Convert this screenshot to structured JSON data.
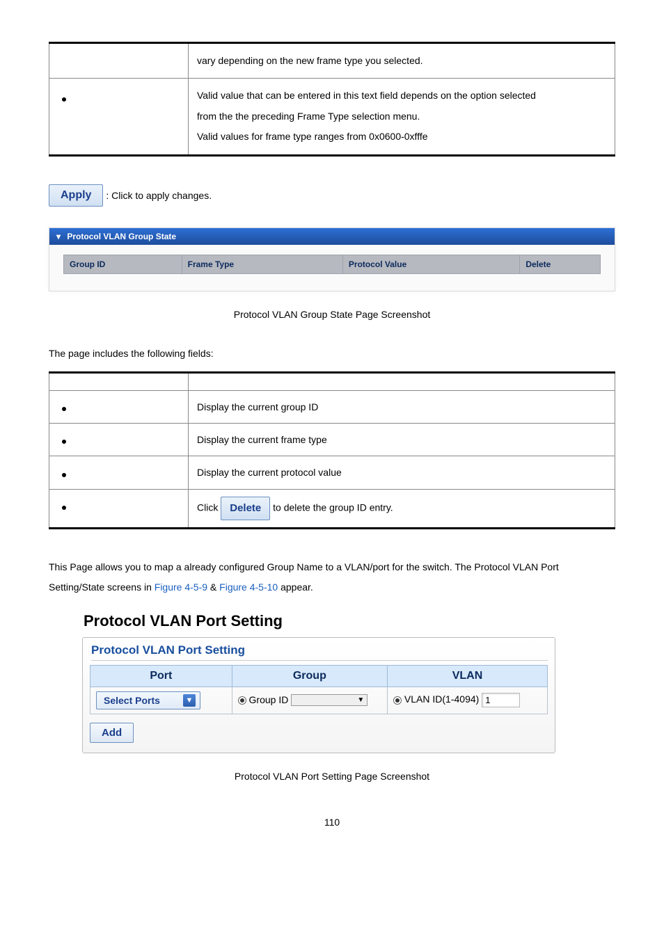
{
  "top_table": {
    "row1_desc": "vary depending on the new frame type you selected.",
    "row2_line1": "Valid value that can be entered in this text field depends on the option selected",
    "row2_line2": "from the the preceding Frame Type selection menu.",
    "row2_line3": "Valid values for frame type ranges from 0x0600-0xfffe"
  },
  "apply": {
    "btn": "Apply",
    "txt": ": Click to apply changes."
  },
  "state_panel": {
    "title": "Protocol VLAN Group State",
    "cols": {
      "group_id": "Group ID",
      "frame_type": "Frame Type",
      "protocol_value": "Protocol Value",
      "delete": "Delete"
    }
  },
  "caption1": "Protocol VLAN Group State Page Screenshot",
  "intro": "The page includes the following fields:",
  "fields_table": {
    "r1": "Display the current group ID",
    "r2": "Display the current frame type",
    "r3": "Display the current protocol value",
    "r4_pre": "Click ",
    "r4_btn": "Delete",
    "r4_post": " to delete the group ID entry."
  },
  "section_text": {
    "pre": "This Page allows you to map a already configured Group Name to a VLAN/port for the switch. The Protocol VLAN Port Setting/State screens in ",
    "link1": "Figure 4-5-9",
    "amp": " & ",
    "link2": "Figure 4-5-10",
    "post": " appear."
  },
  "port_panel": {
    "title": "Protocol VLAN Port Setting",
    "subtitle": "Protocol VLAN Port Setting",
    "headers": {
      "port": "Port",
      "group": "Group",
      "vlan": "VLAN"
    },
    "port_select": "Select Ports",
    "group_label": " Group ID",
    "group_select": "",
    "vlan_label": " VLAN ID(1-4094) ",
    "vlan_value": "1",
    "add": "Add"
  },
  "caption2": "Protocol VLAN Port Setting Page Screenshot",
  "page_number": "110"
}
